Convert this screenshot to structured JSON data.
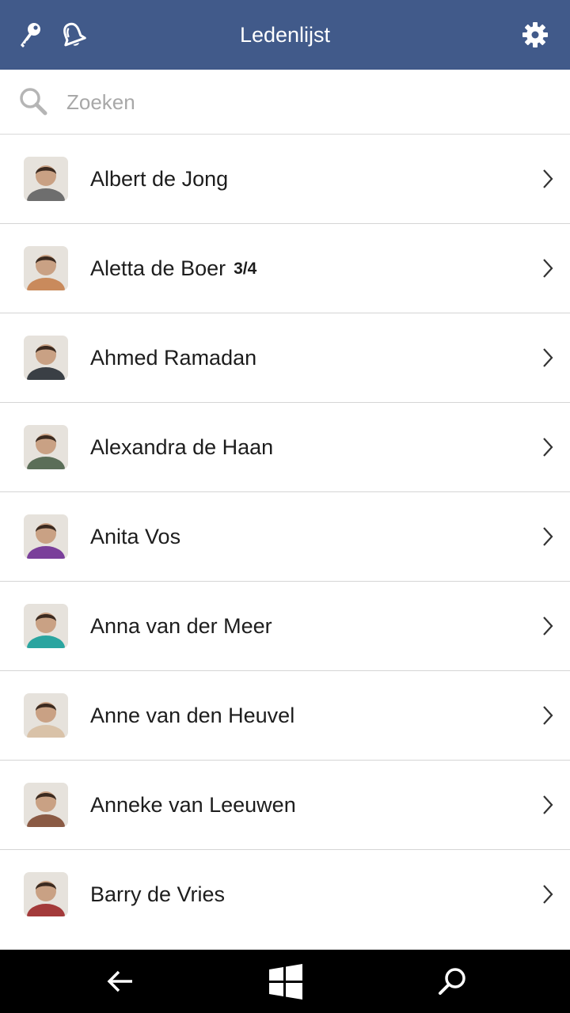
{
  "header": {
    "title": "Ledenlijst",
    "background": "#415a8a",
    "left_icons": [
      "key-icon",
      "bell-icon"
    ],
    "right_icon": "gear-icon"
  },
  "search": {
    "placeholder": "Zoeken",
    "value": "",
    "icon": "search-icon"
  },
  "members": [
    {
      "name": "Albert de Jong",
      "badge": "",
      "avatar_color": "#6e6e6e"
    },
    {
      "name": "Aletta de Boer",
      "badge": "3/4",
      "avatar_color": "#c98a5c"
    },
    {
      "name": "Ahmed Ramadan",
      "badge": "",
      "avatar_color": "#3a3f45"
    },
    {
      "name": "Alexandra de Haan",
      "badge": "",
      "avatar_color": "#5b6e58"
    },
    {
      "name": "Anita Vos",
      "badge": "",
      "avatar_color": "#7a3f9a"
    },
    {
      "name": "Anna van der Meer",
      "badge": "",
      "avatar_color": "#2aa5a0"
    },
    {
      "name": "Anne van den Heuvel",
      "badge": "",
      "avatar_color": "#d9c2a8"
    },
    {
      "name": "Anneke van Leeuwen",
      "badge": "",
      "avatar_color": "#8a5a44"
    },
    {
      "name": "Barry de Vries",
      "badge": "",
      "avatar_color": "#a33a3a"
    }
  ],
  "navbar": {
    "icons": [
      "back-arrow-icon",
      "windows-logo-icon",
      "search-icon"
    ]
  }
}
